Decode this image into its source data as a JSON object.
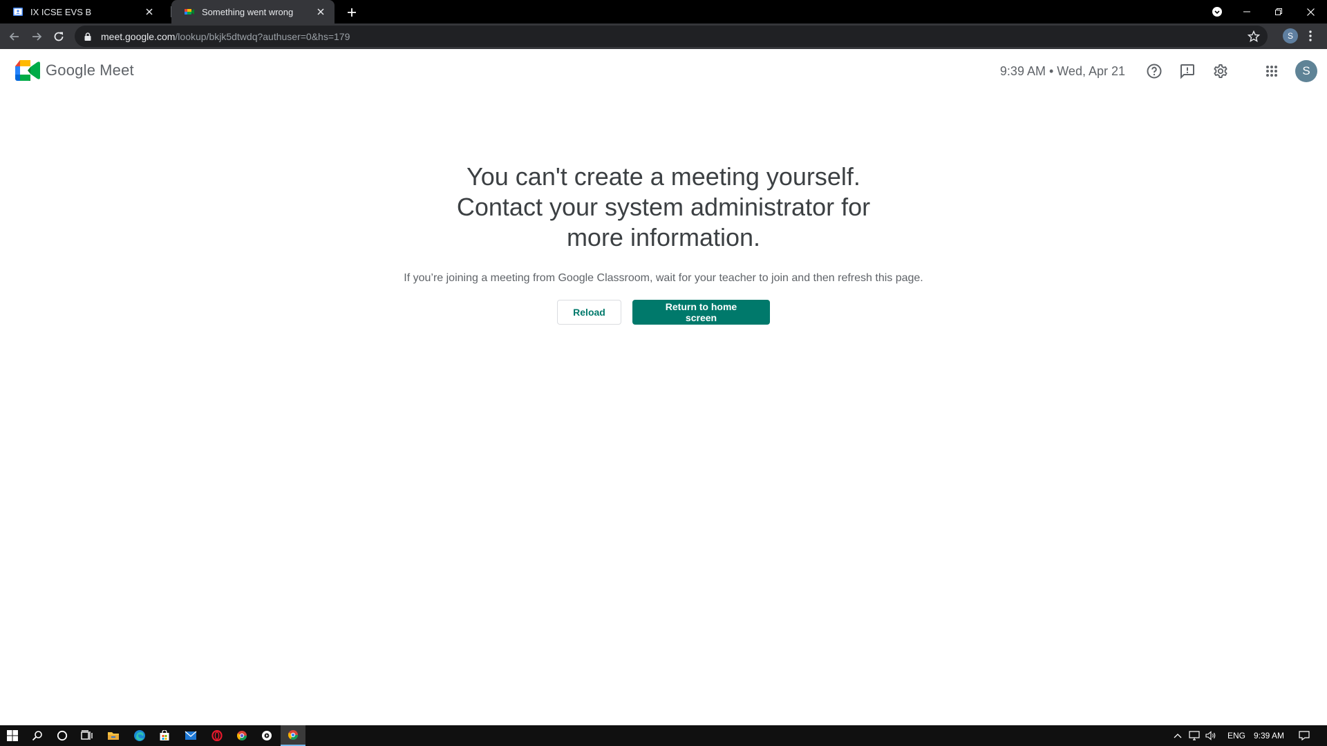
{
  "browser": {
    "tabs": [
      {
        "title": "IX ICSE EVS B",
        "icon": "classroom-icon",
        "active": false
      },
      {
        "title": "Something went wrong",
        "icon": "meet-icon",
        "active": true
      }
    ],
    "url_host": "meet.google.com",
    "url_path": "/lookup/bkjk5dtwdq?authuser=0&hs=179",
    "profile_initial": "S"
  },
  "header": {
    "logo_google": "Google",
    "logo_meet": "Meet",
    "clock": "9:39 AM • Wed, Apr 21",
    "icons": [
      "help-icon",
      "feedback-icon",
      "settings-icon",
      "apps-grid-icon"
    ],
    "avatar_initial": "S"
  },
  "main": {
    "heading": "You can't create a meeting yourself. Contact your system administrator for more information.",
    "subtext": "If you’re joining a meeting from Google Classroom, wait for your teacher to join and then refresh this page.",
    "reload_label": "Reload",
    "home_label": "Return to home screen"
  },
  "colors": {
    "accent": "#00796b",
    "text_primary": "#3c4043",
    "text_secondary": "#5f6368"
  },
  "taskbar": {
    "apps": [
      "start-icon",
      "search-icon",
      "cortana-icon",
      "task-view-icon",
      "file-explorer-icon",
      "edge-icon",
      "store-icon",
      "mail-icon",
      "opera-icon",
      "chrome-alt-icon",
      "media-icon",
      "chrome-icon"
    ],
    "language": "ENG",
    "time": "9:39 AM"
  }
}
